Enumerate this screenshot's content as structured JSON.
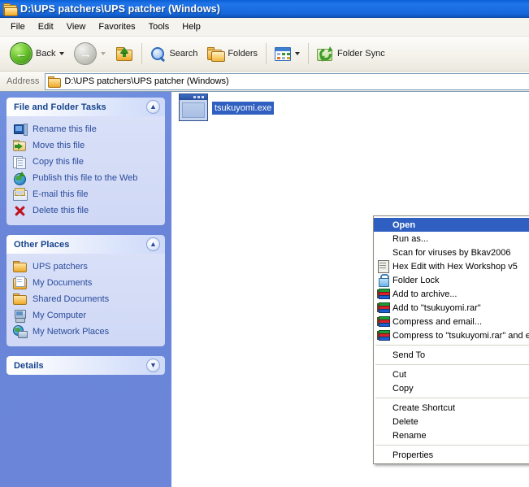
{
  "window": {
    "title": "D:\\UPS patchers\\UPS patcher (Windows)",
    "folder_icon": "folder-icon"
  },
  "menubar": {
    "items": [
      {
        "label": "File"
      },
      {
        "label": "Edit"
      },
      {
        "label": "View"
      },
      {
        "label": "Favorites"
      },
      {
        "label": "Tools"
      },
      {
        "label": "Help"
      }
    ]
  },
  "toolbar": {
    "back_label": "Back",
    "search_label": "Search",
    "folders_label": "Folders",
    "folder_sync_label": "Folder Sync"
  },
  "address": {
    "label": "Address",
    "value": "D:\\UPS patchers\\UPS patcher (Windows)"
  },
  "sidebar": {
    "panels": [
      {
        "title": "File and Folder Tasks",
        "collapsed": false,
        "chevron": "chevron-up-icon",
        "items": [
          {
            "label": "Rename this file",
            "icon": "rename-icon"
          },
          {
            "label": "Move this file",
            "icon": "move-icon"
          },
          {
            "label": "Copy this file",
            "icon": "copy-icon"
          },
          {
            "label": "Publish this file to the Web",
            "icon": "globe-icon"
          },
          {
            "label": "E-mail this file",
            "icon": "mail-icon"
          },
          {
            "label": "Delete this file",
            "icon": "delete-icon"
          }
        ]
      },
      {
        "title": "Other Places",
        "collapsed": false,
        "chevron": "chevron-up-icon",
        "items": [
          {
            "label": "UPS patchers",
            "icon": "folder-icon"
          },
          {
            "label": "My Documents",
            "icon": "my-documents-icon"
          },
          {
            "label": "Shared Documents",
            "icon": "folder-icon"
          },
          {
            "label": "My Computer",
            "icon": "my-computer-icon"
          },
          {
            "label": "My Network Places",
            "icon": "network-places-icon"
          }
        ]
      },
      {
        "title": "Details",
        "collapsed": true,
        "chevron": "chevron-down-icon",
        "items": []
      }
    ]
  },
  "content": {
    "file": {
      "name": "tsukuyomi.exe",
      "icon": "executable-icon",
      "selected": true
    }
  },
  "context_menu": {
    "groups": [
      {
        "items": [
          {
            "label": "Open",
            "icon": null,
            "selected": true,
            "submenu": false
          },
          {
            "label": "Run as...",
            "icon": null,
            "selected": false,
            "submenu": false
          },
          {
            "label": "Scan for viruses by Bkav2006",
            "icon": null,
            "selected": false,
            "submenu": false
          },
          {
            "label": "Hex Edit with Hex Workshop v5",
            "icon": "hex-workshop-icon",
            "selected": false,
            "submenu": false
          },
          {
            "label": "Folder Lock",
            "icon": "padlock-icon",
            "selected": false,
            "submenu": true
          },
          {
            "label": "Add to archive...",
            "icon": "winrar-icon",
            "selected": false,
            "submenu": false
          },
          {
            "label": "Add to \"tsukuyomi.rar\"",
            "icon": "winrar-icon",
            "selected": false,
            "submenu": false
          },
          {
            "label": "Compress and email...",
            "icon": "winrar-icon",
            "selected": false,
            "submenu": false
          },
          {
            "label": "Compress to \"tsukuyomi.rar\" and email",
            "icon": "winrar-icon",
            "selected": false,
            "submenu": false
          }
        ]
      },
      {
        "items": [
          {
            "label": "Send To",
            "icon": null,
            "selected": false,
            "submenu": true
          }
        ]
      },
      {
        "items": [
          {
            "label": "Cut",
            "icon": null,
            "selected": false,
            "submenu": false
          },
          {
            "label": "Copy",
            "icon": null,
            "selected": false,
            "submenu": false
          }
        ]
      },
      {
        "items": [
          {
            "label": "Create Shortcut",
            "icon": null,
            "selected": false,
            "submenu": false
          },
          {
            "label": "Delete",
            "icon": null,
            "selected": false,
            "submenu": false
          },
          {
            "label": "Rename",
            "icon": null,
            "selected": false,
            "submenu": false
          }
        ]
      },
      {
        "items": [
          {
            "label": "Properties",
            "icon": null,
            "selected": false,
            "submenu": false
          }
        ]
      }
    ]
  },
  "colors": {
    "titlebar_blue": "#1b6fe3",
    "sidebar_blue": "#6a85d8",
    "panel_body": "#d6ddf7",
    "panel_title_text": "#15428b",
    "link_text": "#2a4b9b",
    "selection_blue": "#2f5fc0",
    "content_bg": "#ffffff"
  }
}
